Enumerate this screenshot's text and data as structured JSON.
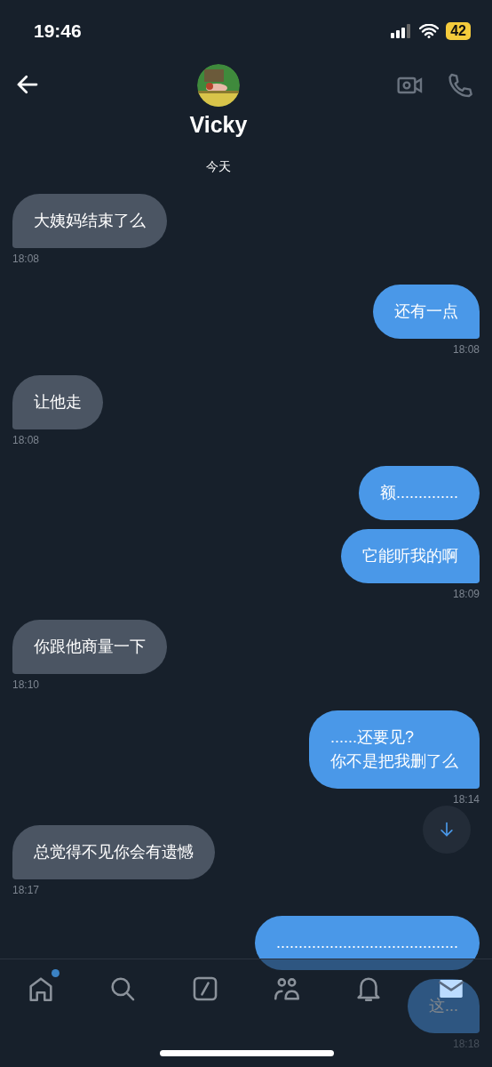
{
  "status_bar": {
    "time": "19:46",
    "battery": "42"
  },
  "header": {
    "name": "Vicky",
    "date": "今天"
  },
  "messages": [
    {
      "kind": "received",
      "text": "大姨妈结束了么",
      "time": "18:08"
    },
    {
      "kind": "sent",
      "text": "还有一点",
      "time": "18:08"
    },
    {
      "kind": "received",
      "text": "让他走",
      "time": "18:08"
    },
    {
      "kind": "sent",
      "text": "额.............."
    },
    {
      "kind": "sent",
      "text": "它能听我的啊",
      "time": "18:09"
    },
    {
      "kind": "received",
      "text": "你跟他商量一下",
      "time": "18:10"
    },
    {
      "kind": "sent",
      "text": "......还要见?\n你不是把我删了么",
      "time": "18:14"
    },
    {
      "kind": "received",
      "text": "总觉得不见你会有遗憾",
      "time": "18:17"
    },
    {
      "kind": "sent",
      "text": "........................................."
    },
    {
      "kind": "sent",
      "text": "这...",
      "time": "18:18"
    }
  ],
  "nav": [
    {
      "kind": "home",
      "badge": true,
      "selected": false
    },
    {
      "kind": "search",
      "badge": false,
      "selected": false
    },
    {
      "kind": "grok",
      "badge": false,
      "selected": false
    },
    {
      "kind": "people",
      "badge": false,
      "selected": false
    },
    {
      "kind": "bell",
      "badge": false,
      "selected": false
    },
    {
      "kind": "mail",
      "badge": false,
      "selected": true
    }
  ]
}
